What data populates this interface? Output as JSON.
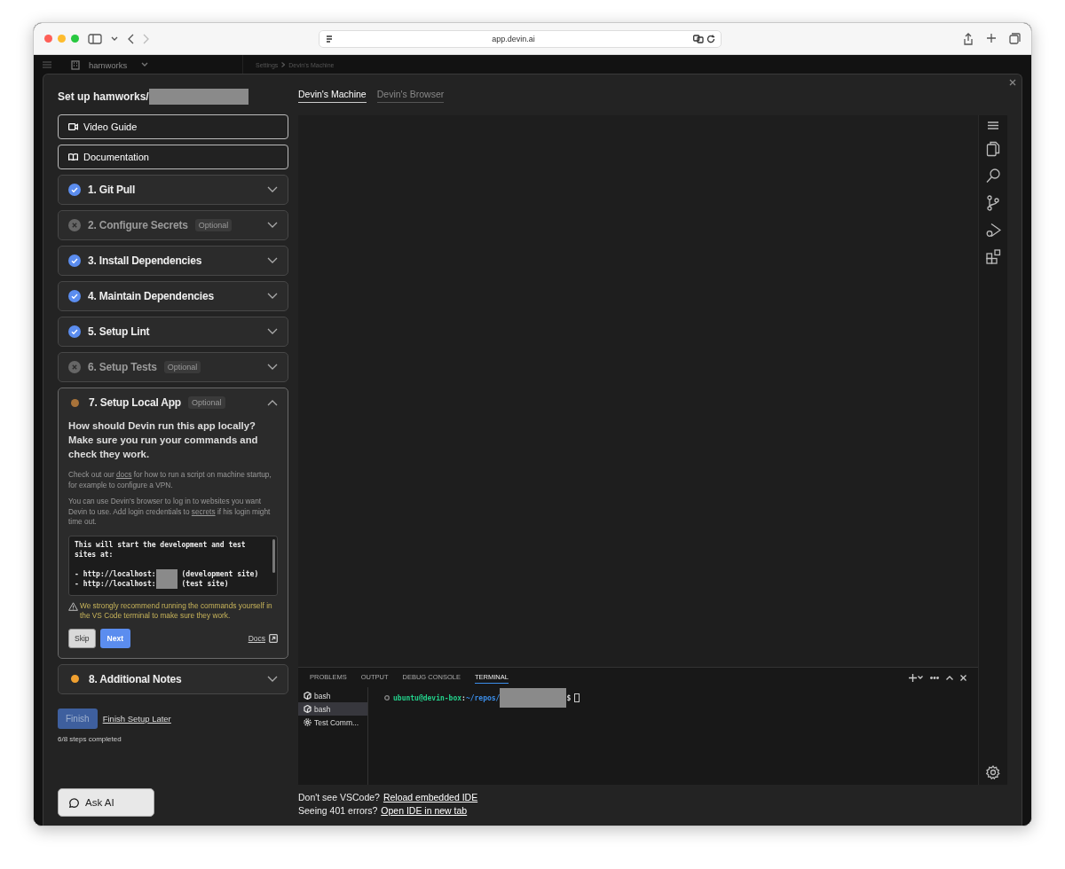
{
  "browser": {
    "url": "app.devin.ai"
  },
  "background": {
    "org": "hamworks",
    "breadcrumb": [
      "Settings",
      "Devin's Machine"
    ]
  },
  "setup": {
    "title": "Set up hamworks/",
    "links": [
      {
        "label": "Video Guide",
        "kind": "video"
      },
      {
        "label": "Documentation",
        "kind": "book"
      }
    ],
    "steps": [
      {
        "label": "1. Git Pull",
        "kind": "done",
        "expanded": false
      },
      {
        "label": "2. Configure Secrets",
        "kind": "skipped",
        "tag": "Optional",
        "expanded": false
      },
      {
        "label": "3. Install Dependencies",
        "kind": "done",
        "expanded": false
      },
      {
        "label": "4. Maintain Dependencies",
        "kind": "done",
        "expanded": false
      },
      {
        "label": "5. Setup Lint",
        "kind": "done",
        "expanded": false
      },
      {
        "label": "6. Setup Tests",
        "kind": "skipped",
        "tag": "Optional",
        "expanded": false
      },
      {
        "label": "7. Setup Local App",
        "kind": "todo",
        "color": "#a8733a",
        "tag": "Optional",
        "expanded": true,
        "body": {
          "question": "How should Devin run this app locally? Make sure you run your commands and check they work.",
          "notes": [
            {
              "before": "Check out our ",
              "link": "docs",
              "after": " for how to run a script on machine startup, for example to configure a VPN."
            },
            {
              "before": "You can use Devin's browser to log in to websites you want Devin to use. Add login credentials to ",
              "link": "secrets",
              "after": " if his login might time out."
            }
          ],
          "code": [
            {
              "text": "This will start the development and test sites at:"
            },
            {
              "text": "- http://localhost:",
              "redacted": true,
              "after": " (development site)"
            },
            {
              "text": "- http://localhost:",
              "redacted": true,
              "after": " (test site)"
            }
          ],
          "warning": "We strongly recommend running the commands yourself in the VS Code terminal to make sure they work.",
          "skip": "Skip",
          "next": "Next",
          "docs": "Docs"
        }
      },
      {
        "label": "8. Additional Notes",
        "kind": "todo",
        "color": "#f0a030",
        "expanded": false
      }
    ],
    "finish": {
      "label": "Finish",
      "disabled": true
    },
    "later": "Finish Setup Later",
    "progress": "6/8 steps completed",
    "ask_ai": "Ask AI"
  },
  "tabs": [
    {
      "label": "Devin's Machine",
      "selected": true
    },
    {
      "label": "Devin's Browser",
      "selected": false
    }
  ],
  "panel_tabs": [
    {
      "label": "PROBLEMS",
      "selected": false
    },
    {
      "label": "OUTPUT",
      "selected": false
    },
    {
      "label": "DEBUG CONSOLE",
      "selected": false
    },
    {
      "label": "TERMINAL",
      "selected": true
    }
  ],
  "terminals": [
    {
      "label": "bash",
      "kind": "shell",
      "selected": false
    },
    {
      "label": "bash",
      "kind": "shell",
      "selected": true
    },
    {
      "label": "Test Comm...",
      "kind": "task",
      "selected": false
    }
  ],
  "prompt": {
    "user": "ubuntu@devin-box",
    "sep": ":",
    "path": "~/repos/",
    "suffix": "$"
  },
  "footer": [
    {
      "text": "Don't see VSCode?",
      "link": "Reload embedded IDE"
    },
    {
      "text": "Seeing 401 errors?",
      "link": "Open IDE in new tab"
    }
  ]
}
